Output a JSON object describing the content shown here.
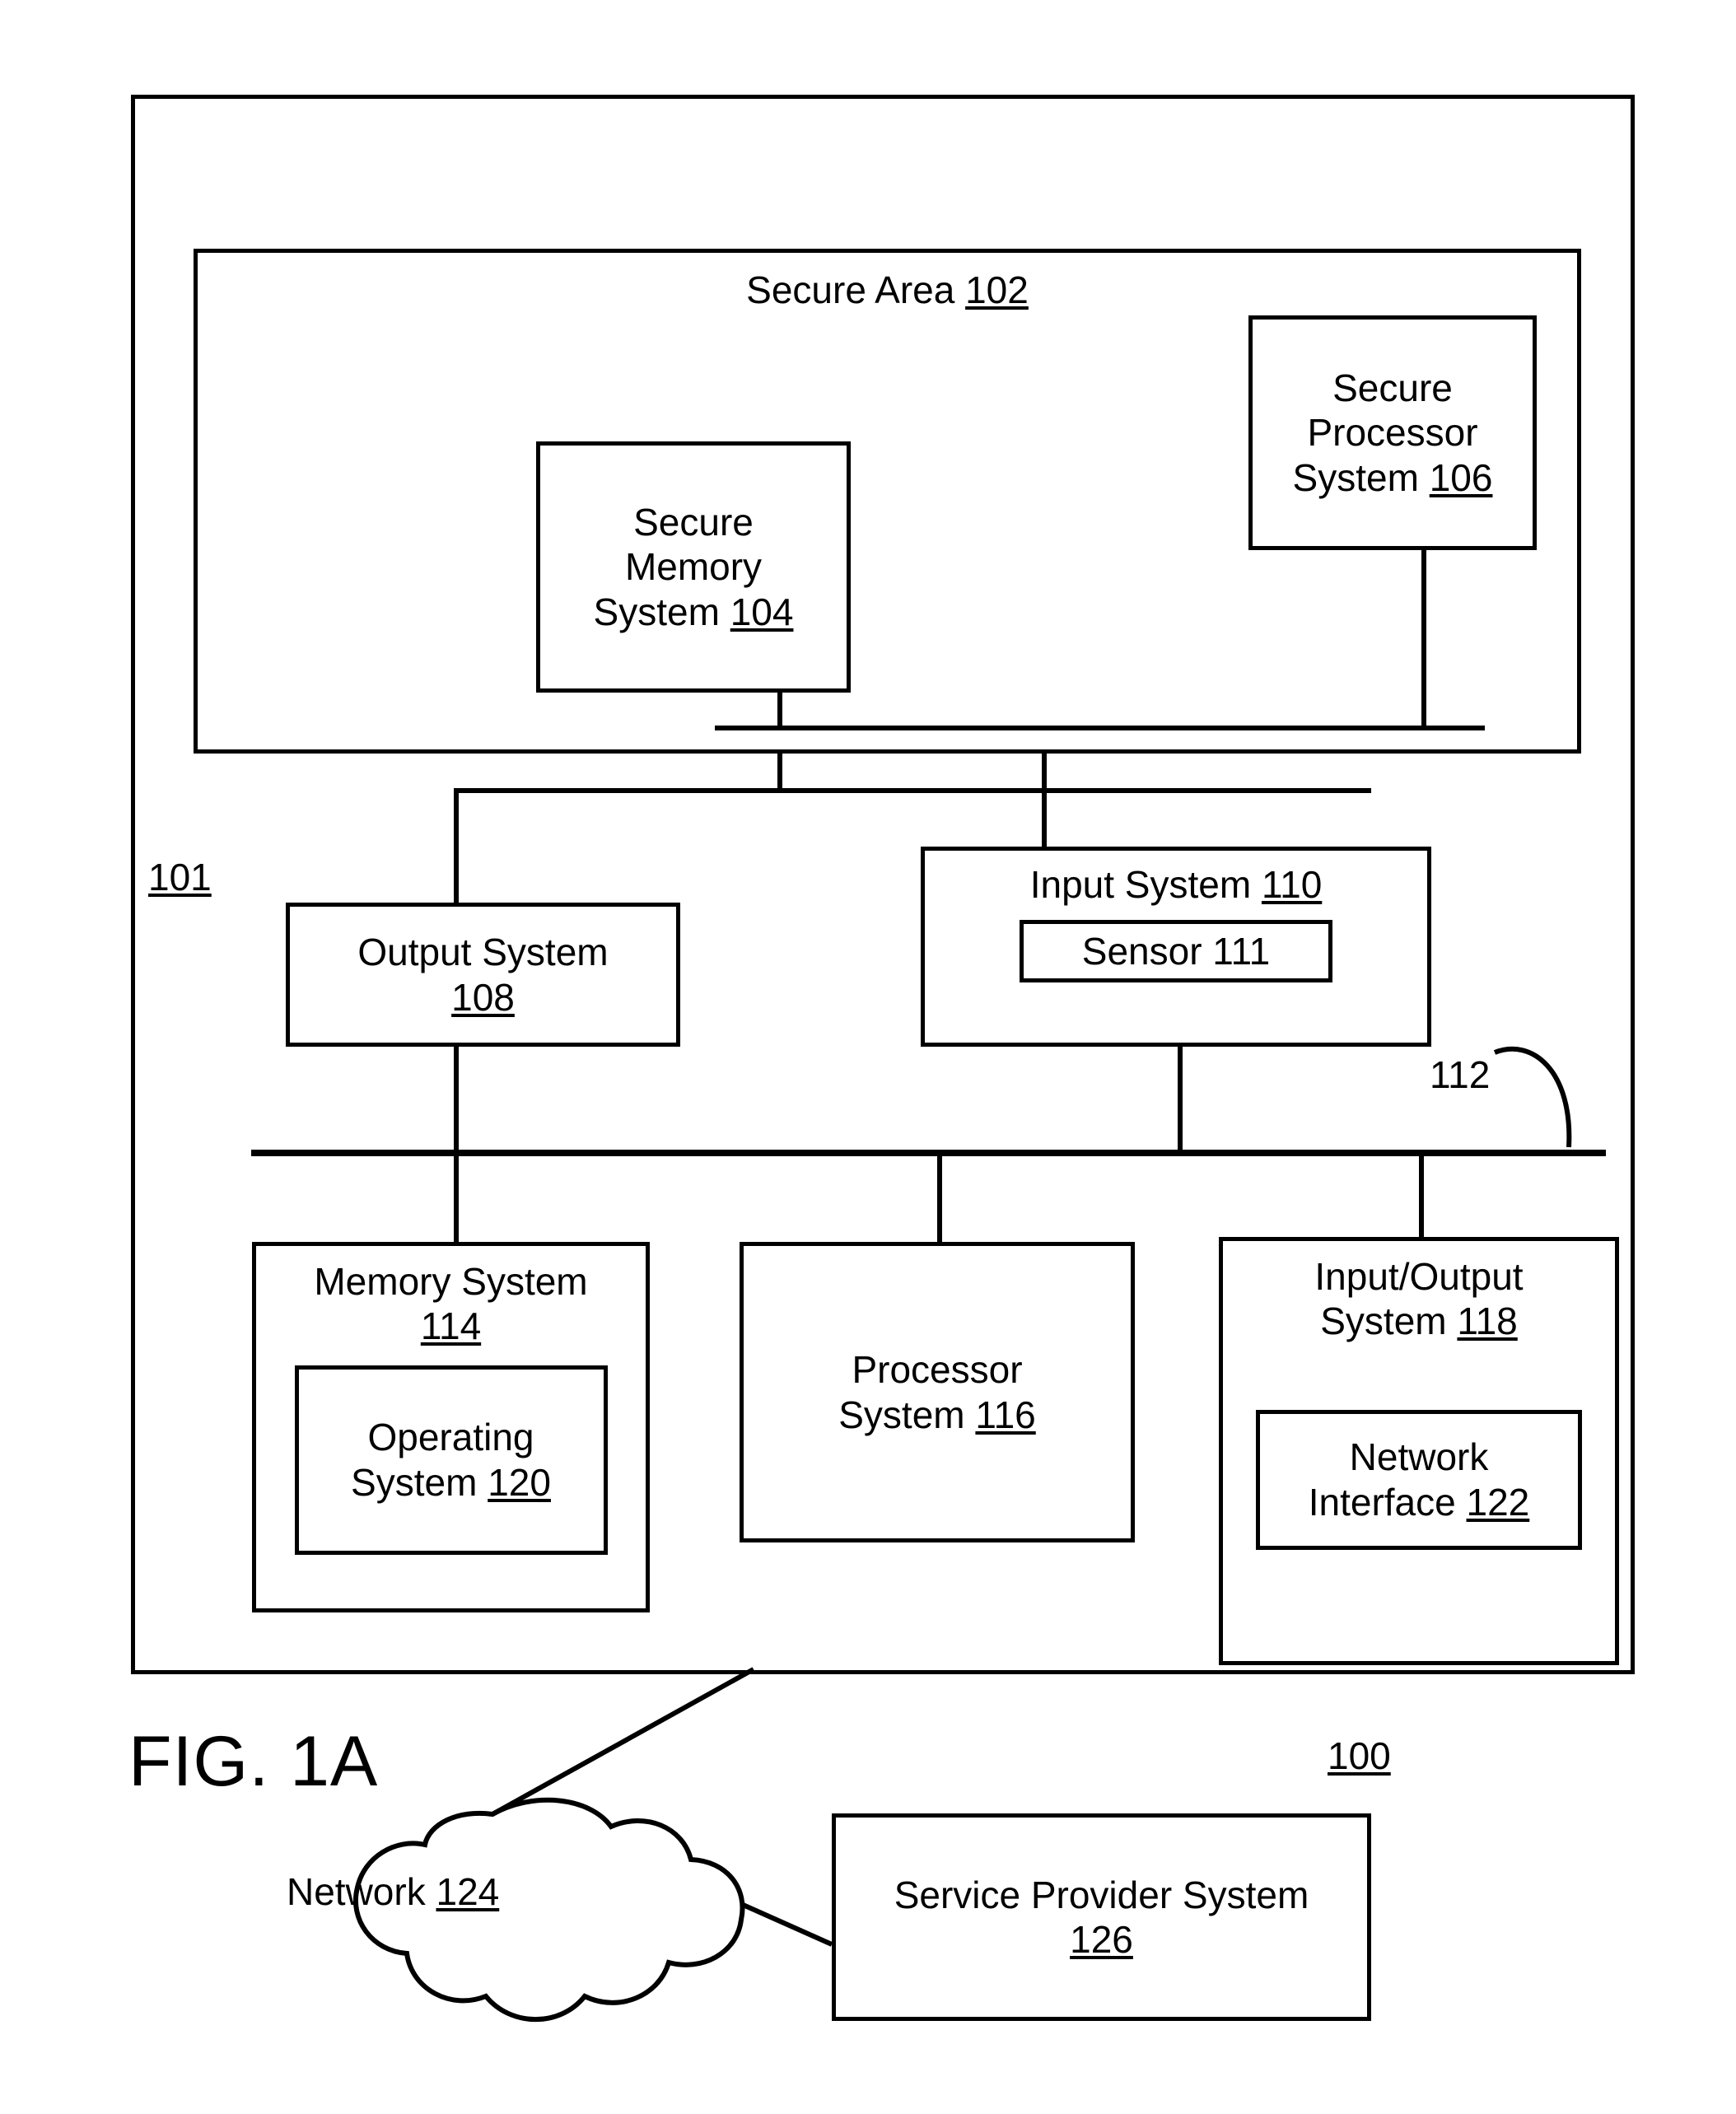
{
  "figure": {
    "label": "FIG. 1A",
    "overall_ref": "100",
    "device_ref": "101",
    "bus_ref": "112"
  },
  "secure_area": {
    "title_text": "Secure Area ",
    "title_ref": "102",
    "blocks": [
      {
        "name": "secure-memory-system",
        "text": "Secure\nMemory\nSystem ",
        "ref": "104"
      },
      {
        "name": "secure-processor-system",
        "text": "Secure\nProcessor\nSystem ",
        "ref": "106"
      }
    ]
  },
  "device": {
    "blocks": [
      {
        "name": "output-system",
        "text": "Output System\n",
        "ref": "108"
      },
      {
        "name": "input-system",
        "text": "Input System ",
        "ref": "110",
        "child": {
          "name": "sensor",
          "text": "Sensor 111",
          "ref": ""
        }
      },
      {
        "name": "memory-system",
        "text": "Memory System\n",
        "ref": "114",
        "child": {
          "name": "operating-system",
          "text": "Operating\nSystem ",
          "ref": "120"
        }
      },
      {
        "name": "processor-system",
        "text": "Processor\nSystem ",
        "ref": "116"
      },
      {
        "name": "input-output-system",
        "text": "Input/Output\nSystem ",
        "ref": "118",
        "child": {
          "name": "network-interface",
          "text": "Network\nInterface ",
          "ref": "122"
        }
      }
    ]
  },
  "external": {
    "network": {
      "text": "Network ",
      "ref": "124"
    },
    "service_provider": {
      "text": "Service Provider System\n",
      "ref": "126"
    }
  },
  "colors": {
    "line": "#000000",
    "background": "#ffffff"
  }
}
